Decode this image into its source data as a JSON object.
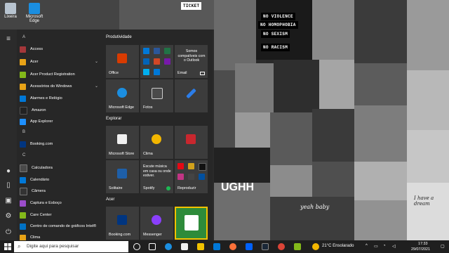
{
  "desktop": {
    "icons": [
      {
        "label": "Lixeira",
        "icon": "recycle-bin-icon"
      },
      {
        "label": "Microsoft Edge",
        "icon": "edge-icon"
      }
    ]
  },
  "collage": {
    "signs": [
      "NO VIOLENCE",
      "NO HOMOPHOBIA",
      "NO SEXISM",
      "NO RACISM"
    ],
    "ticket": "TICKET",
    "poster_text": "UGHH",
    "script_text": "yeah baby",
    "note_text": "I have a dream"
  },
  "start_menu": {
    "rail": [
      "hamburger-icon",
      "user-icon",
      "document-icon",
      "pictures-icon",
      "settings-icon",
      "power-icon"
    ],
    "letters": [
      "A",
      "B",
      "C"
    ],
    "apps": [
      {
        "label": "Access",
        "color": "#a4373a"
      },
      {
        "label": "Acer",
        "color": "#e8a317",
        "expand": true
      },
      {
        "label": "Acer Product Registration",
        "color": "#83b81a"
      },
      {
        "label": "Acessórios do Windows",
        "color": "#e8a317",
        "expand": true
      },
      {
        "label": "Alarmes e Relógio",
        "color": "#0078d7"
      },
      {
        "label": "Amazon",
        "color": "#222222"
      },
      {
        "label": "App Explorer",
        "color": "#1e90ff"
      },
      {
        "label": "Booking.com",
        "color": "#003580"
      },
      {
        "label": "Calculadora",
        "color": "#4a4a4a"
      },
      {
        "label": "Calendário",
        "color": "#0078d7"
      },
      {
        "label": "Câmera",
        "color": "#333333"
      },
      {
        "label": "Captura e Esboço",
        "color": "#9b4dca"
      },
      {
        "label": "Care Center",
        "color": "#83b81a"
      },
      {
        "label": "Centro de comando de gráficos Intel®",
        "color": "#0071c5"
      },
      {
        "label": "Clima",
        "color": "#e8a317"
      }
    ],
    "groups": [
      "Produtividade",
      "Explorar",
      "Acer"
    ],
    "tiles": {
      "office": "Office",
      "email_text": "Somos compatíveis com o Outlook",
      "email": "Email",
      "edge": "Microsoft Edge",
      "photos": "Fotos",
      "store": "Microsoft Store",
      "weather": "Clima",
      "spotify_text": "Escute música em casa ou onde estiver.",
      "spotify": "Spotify",
      "solitaire": "Solitaire",
      "play": "Reproduzir",
      "booking": "Booking.com",
      "messenger": "Messenger"
    }
  },
  "taskbar": {
    "search_placeholder": "Digite aqui para pesquisar",
    "weather": "21°C  Ensolarado",
    "time": "17:33",
    "date": "29/07/2021",
    "apps": [
      "cortana-icon",
      "task-view-icon",
      "edge-icon",
      "store-icon",
      "explorer-icon",
      "mail-icon",
      "firefox-icon",
      "dropbox-icon",
      "steam-icon",
      "chrome-icon",
      "acer-icon"
    ]
  }
}
